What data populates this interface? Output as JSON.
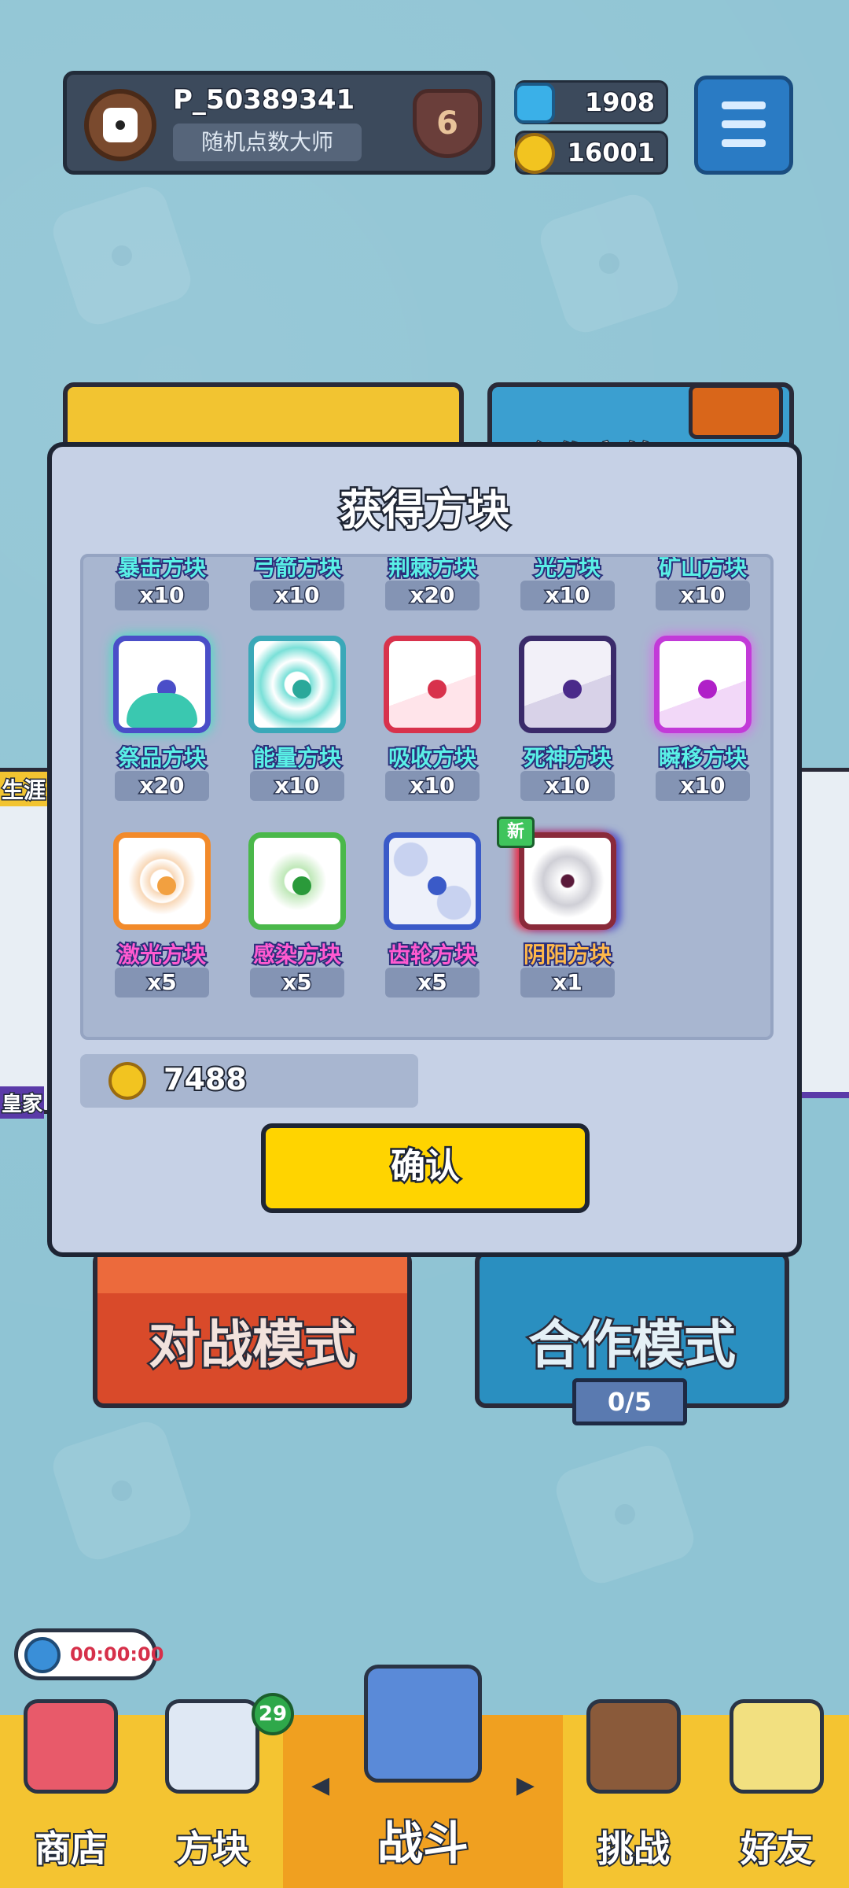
{
  "header": {
    "player_name": "P_50389341",
    "player_title": "随机点数大师",
    "rank": "6",
    "gems": "1908",
    "coins": "16001"
  },
  "modes": {
    "battle": "对战模式",
    "coop": "合作模式",
    "coop_progress": "0/5",
    "coop_partial": "合作宝箱",
    "side_left_top": "生涯",
    "side_left_bottom": "皇家"
  },
  "timer": "00:00:00",
  "nav": {
    "shop": "商店",
    "blocks": "方块",
    "battle": "战斗",
    "challenge": "挑战",
    "friends": "好友",
    "blocks_badge": "29"
  },
  "dialog": {
    "title": "获得方块",
    "rows": [
      [
        {
          "name": "暴击方块",
          "count": "x10"
        },
        {
          "name": "弓箭方块",
          "count": "x10"
        },
        {
          "name": "荆棘方块",
          "count": "x20"
        },
        {
          "name": "光方块",
          "count": "x10"
        },
        {
          "name": "矿山方块",
          "count": "x10"
        }
      ],
      [
        {
          "name": "祭品方块",
          "count": "x20",
          "color": "#2fc9b0",
          "core": "#4a4ec8"
        },
        {
          "name": "能量方块",
          "count": "x10",
          "color": "#3aa8b8",
          "core": "#2aa89a"
        },
        {
          "name": "吸收方块",
          "count": "x10",
          "color": "#d8324c",
          "core": "#d8324c"
        },
        {
          "name": "死神方块",
          "count": "x10",
          "color": "#3a2a6a",
          "core": "#4a2a8a"
        },
        {
          "name": "瞬移方块",
          "count": "x10",
          "color": "#c23ad8",
          "core": "#b020c8"
        }
      ],
      [
        {
          "name": "激光方块",
          "count": "x5",
          "color": "#f28a2a",
          "core": "#f2a040"
        },
        {
          "name": "感染方块",
          "count": "x5",
          "color": "#4ab84a",
          "core": "#2a9a3a"
        },
        {
          "name": "齿轮方块",
          "count": "x5",
          "color": "#3a5ac8",
          "core": "#3a5ac8"
        },
        {
          "name": "阴阳方块",
          "count": "x1",
          "color": "#8a2a3a",
          "core": "#5a1a3a",
          "new": "新"
        }
      ]
    ],
    "coins": "7488",
    "confirm": "确认"
  },
  "colors": {
    "dialog_bg": "#c6d1e6",
    "confirm": "#ffd400",
    "battle_card": "#d94a2a",
    "coop_card": "#2a8fc0"
  }
}
